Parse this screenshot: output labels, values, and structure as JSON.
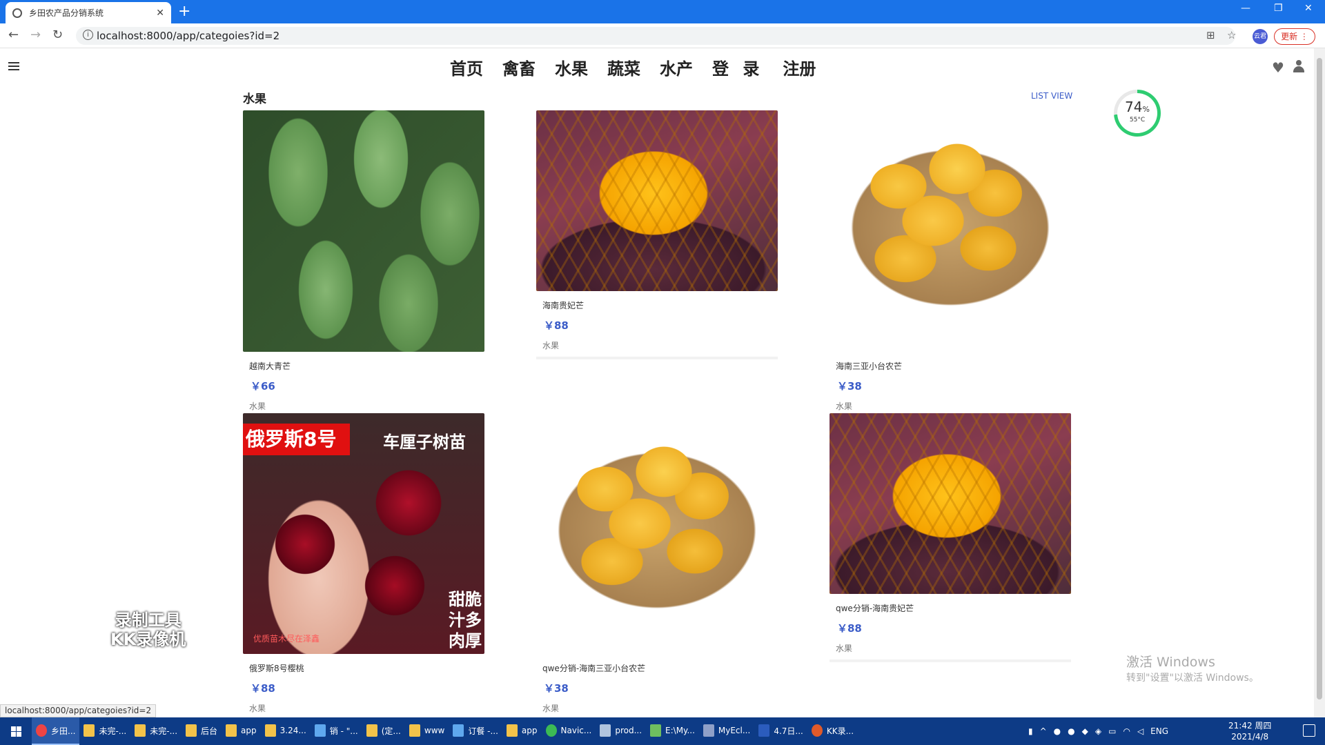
{
  "browser": {
    "tab_title": "乡田农产品分销系统",
    "url": "localhost:8000/app/categoies?id=2",
    "update_label": "更新",
    "profile_label": "云君",
    "status_url": "localhost:8000/app/categoies?id=2"
  },
  "site": {
    "nav": [
      "首页",
      "禽畜",
      "水果",
      "蔬菜",
      "水产",
      "登 录",
      "注册"
    ],
    "page_title": "水果",
    "list_view": "LIST VIEW",
    "gauge": {
      "percent": "74",
      "percent_sign": "%",
      "temp": "55°C"
    }
  },
  "products": [
    {
      "name": "越南大青芒",
      "price": "￥66",
      "category": "水果"
    },
    {
      "name": "海南贵妃芒",
      "price": "￥88",
      "category": "水果"
    },
    {
      "name": "海南三亚小台农芒",
      "price": "￥38",
      "category": "水果"
    },
    {
      "name": "俄罗斯8号樱桃",
      "price": "￥88",
      "category": "水果",
      "image_text": {
        "banner": "俄罗斯8号",
        "banner2": "车厘子树苗",
        "side": "甜脆汁多肉厚",
        "foot": "优质苗木尽在泽鑫"
      }
    },
    {
      "name": "qwe分销-海南三亚小台农芒",
      "price": "￥38",
      "category": "水果"
    },
    {
      "name": "qwe分销-海南贵妃芒",
      "price": "￥88",
      "category": "水果"
    }
  ],
  "overlays": {
    "kk_watermark_line1": "录制工具",
    "kk_watermark_line2": "KK录像机",
    "activate_title": "激活 Windows",
    "activate_sub": "转到\"设置\"以激活 Windows。"
  },
  "taskbar": {
    "items": [
      "乡田...",
      "未完-...",
      "未完-...",
      "后台",
      "app",
      "3.24...",
      "销 - \"...",
      "(定...",
      "www",
      "订餐 -...",
      "app",
      "Navic...",
      "prod...",
      "E:\\My...",
      "MyEcl...",
      "4.7日...",
      "KK录..."
    ],
    "lang": "ENG",
    "time": "21:42 周四",
    "date": "2021/4/8"
  },
  "colors": {
    "accent": "#3b5cc8",
    "chrome": "#1a73e8",
    "taskbar": "#0d3b86",
    "gauge": "#2ecc71"
  },
  "icons": [
    "menu-icon",
    "heart-icon",
    "user-icon",
    "back-icon",
    "forward-icon",
    "reload-icon",
    "star-icon",
    "translate-icon",
    "windows-start-icon"
  ]
}
